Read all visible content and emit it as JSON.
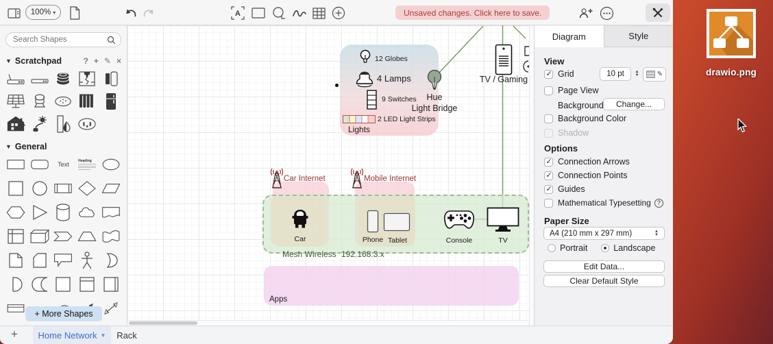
{
  "toolbar": {
    "zoom_level": "100%",
    "unsaved_message": "Unsaved changes. Click here to save.",
    "icons": [
      "format-panel-toggle",
      "page",
      "undo",
      "redo",
      "text-tool",
      "rectangle-tool",
      "ellipse-tool",
      "freehand-tool",
      "table-tool",
      "add-shape",
      "share-person-add",
      "more-options",
      "extension-tools"
    ]
  },
  "sidebar": {
    "search_placeholder": "Search Shapes",
    "scratchpad": {
      "title": "Scratchpad",
      "tools": [
        "help",
        "add",
        "edit",
        "close"
      ],
      "shapes": [
        "router",
        "switch",
        "disk-stack",
        "printer-3d",
        "wall-dimmer",
        "solar-panel",
        "pedestal-lamp",
        "smoke-detector",
        "radiator",
        "fridge",
        "smart-home",
        "plant-sensor",
        "door-leak-sensor",
        "power-outlet"
      ]
    },
    "general": {
      "title": "General",
      "text_shape_label": "Text",
      "heading_shape_label": "Heading",
      "shapes": [
        "rectangle",
        "rounded-rectangle",
        "text",
        "textbox",
        "ellipse",
        "square",
        "circle",
        "process",
        "diamond",
        "parallelogram",
        "hexagon",
        "triangle",
        "cylinder",
        "cloud",
        "document",
        "internal-storage",
        "cube",
        "step",
        "trapezoid",
        "tape",
        "note",
        "card",
        "callout",
        "actor",
        "or",
        "and",
        "data-storage",
        "plain-square",
        "container",
        "vertical-container",
        "horizontal-container",
        "curve",
        "directional-connector",
        "bidirectional-connector"
      ]
    },
    "more_shapes_button": "+ More Shapes"
  },
  "canvas": {
    "lights_group": {
      "label": "Lights",
      "items": [
        {
          "icon": "bulb-icon",
          "label": "12 Globes"
        },
        {
          "icon": "lamp-icon",
          "label": "4 Lamps"
        },
        {
          "icon": "switch-stack-icon",
          "label": "9 Switches"
        },
        {
          "icon": "led-strip-icon",
          "label": "2 LED Light Strips"
        }
      ]
    },
    "hue_bridge": {
      "label_line1": "Hue",
      "label_line2": "Light Bridge"
    },
    "tv_gaming": {
      "label": "TV / Gaming"
    },
    "car_internet": {
      "label": "Car Internet"
    },
    "mobile_internet": {
      "label": "Mobile Internet"
    },
    "mesh": {
      "label": "Mesh Wireless",
      "subnet": "192.168.3.x",
      "devices": [
        "Car",
        "Phone",
        "Tablet",
        "Console",
        "TV"
      ]
    },
    "apps": {
      "label": "Apps"
    }
  },
  "panel": {
    "tabs": [
      {
        "label": "Diagram",
        "active": true
      },
      {
        "label": "Style",
        "active": false
      }
    ],
    "view": {
      "title": "View",
      "grid_label": "Grid",
      "grid_checked": true,
      "grid_size": "10 pt",
      "page_view_label": "Page View",
      "page_view_checked": false,
      "background_label": "Background",
      "change_button": "Change...",
      "background_color_label": "Background Color",
      "background_color_checked": false,
      "shadow_label": "Shadow",
      "shadow_checked": false,
      "shadow_disabled": true
    },
    "options": {
      "title": "Options",
      "items": [
        {
          "label": "Connection Arrows",
          "checked": true
        },
        {
          "label": "Connection Points",
          "checked": true
        },
        {
          "label": "Guides",
          "checked": true
        },
        {
          "label": "Mathematical Typesetting",
          "checked": false,
          "has_help": true
        }
      ]
    },
    "paper": {
      "title": "Paper Size",
      "size": "A4 (210 mm x 297 mm)",
      "portrait_label": "Portrait",
      "landscape_label": "Landscape",
      "orientation": "landscape"
    },
    "buttons": {
      "edit_data": "Edit Data...",
      "clear_default_style": "Clear Default Style"
    }
  },
  "statusbar": {
    "add_page_label": "+",
    "pages": [
      {
        "label": "Home Network",
        "active": true
      },
      {
        "label": "Rack",
        "active": false
      }
    ]
  },
  "desktop": {
    "icon_label": "drawio.png"
  },
  "colors": {
    "accent_blue": "#3e6dd0",
    "unsaved_bg": "#f3d1d1",
    "unsaved_text": "#b03a3a",
    "connector_green": "#7a9e63",
    "mesh_fill": "#d6e9d0",
    "mesh_label_text": "#3d5c35",
    "internet_zone_pink": "#f7cdd5",
    "device_zone_beige": "#e5e0c8",
    "apps_fill": "#f3d3f0",
    "internet_label_text": "#9c3632",
    "desktop_orange": "#c94a2b",
    "drawio_icon_orange": "#e08a2b"
  }
}
